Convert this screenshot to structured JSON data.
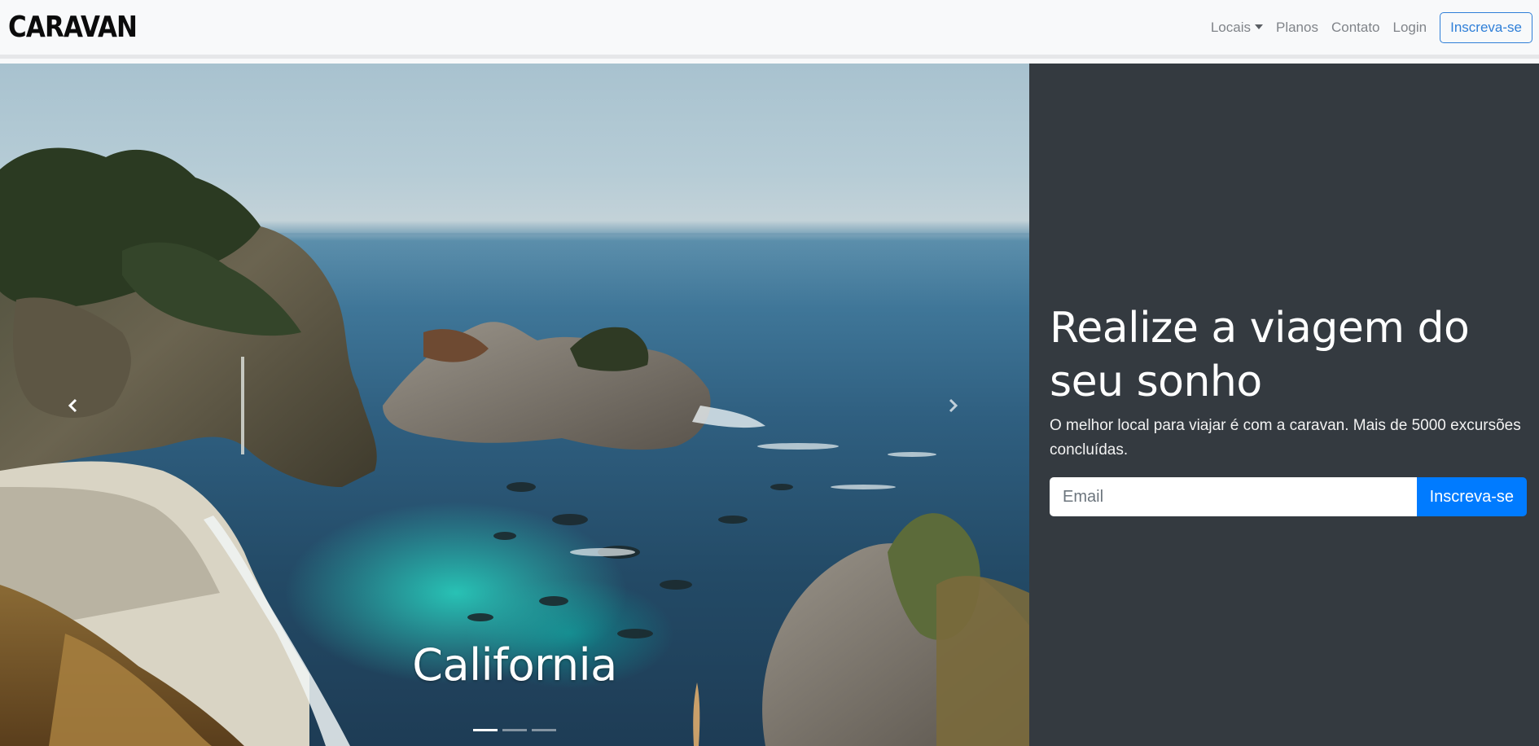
{
  "navbar": {
    "brand": "CARAVAN",
    "links": [
      {
        "label": "Locais",
        "dropdown": true
      },
      {
        "label": "Planos"
      },
      {
        "label": "Contato"
      },
      {
        "label": "Login"
      }
    ],
    "signup_label": "Inscreva-se"
  },
  "carousel": {
    "caption": "California",
    "prev_icon": "chevron-left-icon",
    "next_icon": "chevron-right-icon",
    "slide_count": 3,
    "active_index": 0
  },
  "promo": {
    "headline": "Realize a viagem do seu sonho",
    "lead": "O melhor local para viajar é com a caravan. Mais de 5000 excursões concluídas.",
    "email_placeholder": "Email",
    "signup_label": "Inscreva-se"
  },
  "colors": {
    "primary": "#007bff",
    "panel": "#343a40",
    "navbar": "#f8f9fa"
  }
}
